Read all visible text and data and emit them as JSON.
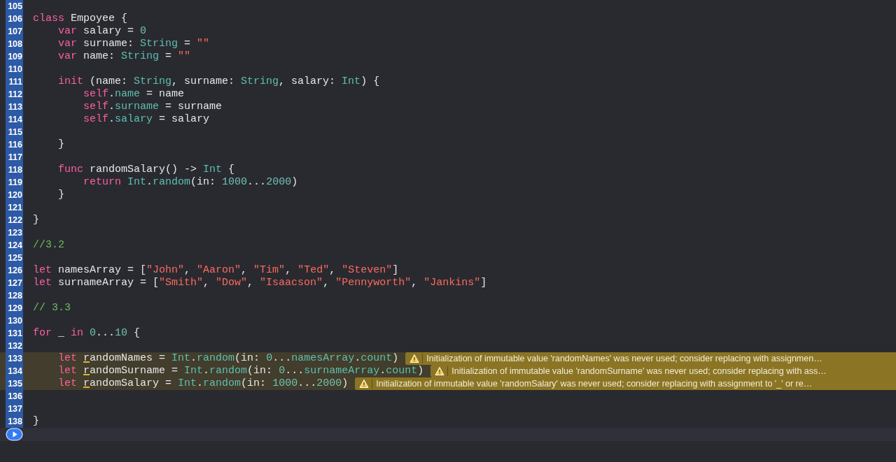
{
  "editor": {
    "lines": [
      {
        "number": "105"
      },
      {
        "number": "106",
        "tokens": [
          {
            "kind": "keyword",
            "text": "class"
          },
          {
            "kind": "plain",
            "text": " Empoyee {"
          }
        ]
      },
      {
        "number": "107",
        "tokens": [
          {
            "kind": "keyword",
            "text": "    var"
          },
          {
            "kind": "plain",
            "text": " salary = "
          },
          {
            "kind": "number",
            "text": "0"
          }
        ]
      },
      {
        "number": "108",
        "tokens": [
          {
            "kind": "keyword",
            "text": "    var"
          },
          {
            "kind": "plain",
            "text": " surname: "
          },
          {
            "kind": "type",
            "text": "String"
          },
          {
            "kind": "plain",
            "text": " = "
          },
          {
            "kind": "string",
            "text": "\"\""
          }
        ]
      },
      {
        "number": "109",
        "tokens": [
          {
            "kind": "keyword",
            "text": "    var"
          },
          {
            "kind": "plain",
            "text": " name: "
          },
          {
            "kind": "type",
            "text": "String"
          },
          {
            "kind": "plain",
            "text": " = "
          },
          {
            "kind": "string",
            "text": "\"\""
          }
        ]
      },
      {
        "number": "110"
      },
      {
        "number": "111",
        "tokens": [
          {
            "kind": "keyword",
            "text": "    init"
          },
          {
            "kind": "plain",
            "text": " (name: "
          },
          {
            "kind": "type",
            "text": "String"
          },
          {
            "kind": "plain",
            "text": ", surname: "
          },
          {
            "kind": "type",
            "text": "String"
          },
          {
            "kind": "plain",
            "text": ", salary: "
          },
          {
            "kind": "type",
            "text": "Int"
          },
          {
            "kind": "plain",
            "text": ") {"
          }
        ]
      },
      {
        "number": "112",
        "tokens": [
          {
            "kind": "keyword",
            "text": "        self"
          },
          {
            "kind": "plain",
            "text": "."
          },
          {
            "kind": "type",
            "text": "name"
          },
          {
            "kind": "plain",
            "text": " = name"
          }
        ]
      },
      {
        "number": "113",
        "tokens": [
          {
            "kind": "keyword",
            "text": "        self"
          },
          {
            "kind": "plain",
            "text": "."
          },
          {
            "kind": "type",
            "text": "surname"
          },
          {
            "kind": "plain",
            "text": " = surname"
          }
        ]
      },
      {
        "number": "114",
        "tokens": [
          {
            "kind": "keyword",
            "text": "        self"
          },
          {
            "kind": "plain",
            "text": "."
          },
          {
            "kind": "type",
            "text": "salary"
          },
          {
            "kind": "plain",
            "text": " = salary"
          }
        ]
      },
      {
        "number": "115"
      },
      {
        "number": "116",
        "tokens": [
          {
            "kind": "plain",
            "text": "    }"
          }
        ]
      },
      {
        "number": "117"
      },
      {
        "number": "118",
        "tokens": [
          {
            "kind": "keyword",
            "text": "    func"
          },
          {
            "kind": "plain",
            "text": " randomSalary() -> "
          },
          {
            "kind": "type",
            "text": "Int"
          },
          {
            "kind": "plain",
            "text": " {"
          }
        ]
      },
      {
        "number": "119",
        "tokens": [
          {
            "kind": "keyword",
            "text": "        return "
          },
          {
            "kind": "type",
            "text": "Int"
          },
          {
            "kind": "plain",
            "text": "."
          },
          {
            "kind": "type",
            "text": "random"
          },
          {
            "kind": "plain",
            "text": "(in: "
          },
          {
            "kind": "number",
            "text": "1000"
          },
          {
            "kind": "plain",
            "text": "..."
          },
          {
            "kind": "number",
            "text": "2000"
          },
          {
            "kind": "plain",
            "text": ")"
          }
        ]
      },
      {
        "number": "120",
        "tokens": [
          {
            "kind": "plain",
            "text": "    }"
          }
        ]
      },
      {
        "number": "121"
      },
      {
        "number": "122",
        "tokens": [
          {
            "kind": "plain",
            "text": "}"
          }
        ]
      },
      {
        "number": "123"
      },
      {
        "number": "124",
        "tokens": [
          {
            "kind": "comment",
            "text": "//3.2"
          }
        ]
      },
      {
        "number": "125"
      },
      {
        "number": "126",
        "tokens": [
          {
            "kind": "keyword",
            "text": "let"
          },
          {
            "kind": "plain",
            "text": " namesArray = ["
          },
          {
            "kind": "string",
            "text": "\"John\""
          },
          {
            "kind": "plain",
            "text": ", "
          },
          {
            "kind": "string",
            "text": "\"Aaron\""
          },
          {
            "kind": "plain",
            "text": ", "
          },
          {
            "kind": "string",
            "text": "\"Tim\""
          },
          {
            "kind": "plain",
            "text": ", "
          },
          {
            "kind": "string",
            "text": "\"Ted\""
          },
          {
            "kind": "plain",
            "text": ", "
          },
          {
            "kind": "string",
            "text": "\"Steven\""
          },
          {
            "kind": "plain",
            "text": "]"
          }
        ]
      },
      {
        "number": "127",
        "tokens": [
          {
            "kind": "keyword",
            "text": "let"
          },
          {
            "kind": "plain",
            "text": " surnameArray = ["
          },
          {
            "kind": "string",
            "text": "\"Smith\""
          },
          {
            "kind": "plain",
            "text": ", "
          },
          {
            "kind": "string",
            "text": "\"Dow\""
          },
          {
            "kind": "plain",
            "text": ", "
          },
          {
            "kind": "string",
            "text": "\"Isaacson\""
          },
          {
            "kind": "plain",
            "text": ", "
          },
          {
            "kind": "string",
            "text": "\"Pennyworth\""
          },
          {
            "kind": "plain",
            "text": ", "
          },
          {
            "kind": "string",
            "text": "\"Jankins\""
          },
          {
            "kind": "plain",
            "text": "]"
          }
        ]
      },
      {
        "number": "128"
      },
      {
        "number": "129",
        "tokens": [
          {
            "kind": "comment",
            "text": "// 3.3"
          }
        ]
      },
      {
        "number": "130"
      },
      {
        "number": "131",
        "tokens": [
          {
            "kind": "keyword",
            "text": "for"
          },
          {
            "kind": "plain",
            "text": " _ "
          },
          {
            "kind": "keyword",
            "text": "in "
          },
          {
            "kind": "number",
            "text": "0"
          },
          {
            "kind": "plain",
            "text": "..."
          },
          {
            "kind": "number",
            "text": "10"
          },
          {
            "kind": "plain",
            "text": " {"
          }
        ]
      },
      {
        "number": "132"
      },
      {
        "number": "133",
        "tokens": [
          {
            "kind": "keyword",
            "text": "    let "
          },
          {
            "kind": "flagged",
            "text": "r"
          },
          {
            "kind": "plain",
            "text": "andomNames = "
          },
          {
            "kind": "type",
            "text": "Int"
          },
          {
            "kind": "plain",
            "text": "."
          },
          {
            "kind": "type",
            "text": "random"
          },
          {
            "kind": "plain",
            "text": "(in: "
          },
          {
            "kind": "number",
            "text": "0"
          },
          {
            "kind": "plain",
            "text": "..."
          },
          {
            "kind": "type",
            "text": "namesArray"
          },
          {
            "kind": "plain",
            "text": "."
          },
          {
            "kind": "type",
            "text": "count"
          },
          {
            "kind": "plain",
            "text": ")"
          }
        ],
        "warning": "Initialization of immutable value 'randomNames' was never used; consider replacing with assignmen…"
      },
      {
        "number": "134",
        "tokens": [
          {
            "kind": "keyword",
            "text": "    let "
          },
          {
            "kind": "flagged",
            "text": "r"
          },
          {
            "kind": "plain",
            "text": "andomSurname = "
          },
          {
            "kind": "type",
            "text": "Int"
          },
          {
            "kind": "plain",
            "text": "."
          },
          {
            "kind": "type",
            "text": "random"
          },
          {
            "kind": "plain",
            "text": "(in: "
          },
          {
            "kind": "number",
            "text": "0"
          },
          {
            "kind": "plain",
            "text": "..."
          },
          {
            "kind": "type",
            "text": "surnameArray"
          },
          {
            "kind": "plain",
            "text": "."
          },
          {
            "kind": "type",
            "text": "count"
          },
          {
            "kind": "plain",
            "text": ")"
          }
        ],
        "warning": "Initialization of immutable value 'randomSurname' was never used; consider replacing with ass…"
      },
      {
        "number": "135",
        "tokens": [
          {
            "kind": "keyword",
            "text": "    let "
          },
          {
            "kind": "flagged",
            "text": "r"
          },
          {
            "kind": "plain",
            "text": "andomSalary = "
          },
          {
            "kind": "type",
            "text": "Int"
          },
          {
            "kind": "plain",
            "text": "."
          },
          {
            "kind": "type",
            "text": "random"
          },
          {
            "kind": "plain",
            "text": "(in: "
          },
          {
            "kind": "number",
            "text": "1000"
          },
          {
            "kind": "plain",
            "text": "..."
          },
          {
            "kind": "number",
            "text": "2000"
          },
          {
            "kind": "plain",
            "text": ")"
          }
        ],
        "warning": "Initialization of immutable value 'randomSalary' was never used; consider replacing with assignment to '_' or re…"
      },
      {
        "number": "136"
      },
      {
        "number": "137"
      },
      {
        "number": "138",
        "tokens": [
          {
            "kind": "plain",
            "text": "}"
          }
        ]
      }
    ]
  }
}
